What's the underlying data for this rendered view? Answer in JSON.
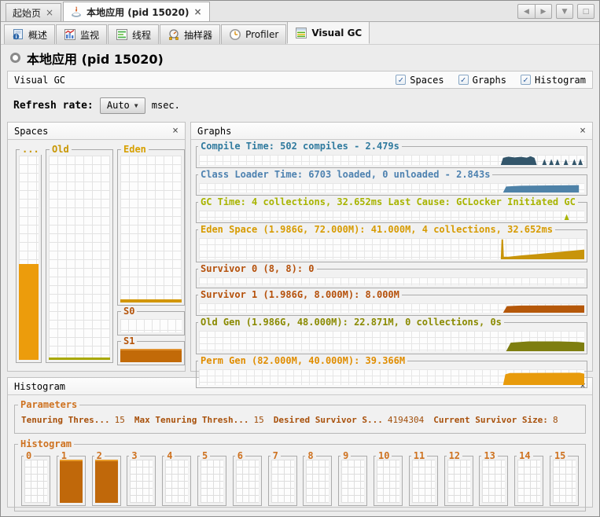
{
  "glyphs": {
    "close": "×",
    "check": "✓",
    "caret_down": "▼",
    "nav_left": "◀",
    "nav_right": "▶",
    "maximize": "□"
  },
  "doc_tabbar": {
    "tabs": [
      {
        "label": "起始页",
        "selected": false
      },
      {
        "label": "本地应用 (pid 15020)",
        "selected": true
      }
    ]
  },
  "view_tabbar": {
    "tabs": [
      {
        "label": "概述"
      },
      {
        "label": "监视"
      },
      {
        "label": "线程"
      },
      {
        "label": "抽样器"
      },
      {
        "label": "Profiler"
      },
      {
        "label": "Visual GC",
        "selected": true
      }
    ]
  },
  "page": {
    "title": "本地应用 (pid 15020)"
  },
  "toolbar": {
    "label": "Visual GC",
    "checkboxes": [
      {
        "label": "Spaces",
        "checked": true
      },
      {
        "label": "Graphs",
        "checked": true
      },
      {
        "label": "Histogram",
        "checked": true
      }
    ],
    "refresh": {
      "label": "Refresh rate:",
      "value": "Auto",
      "unit": "msec."
    }
  },
  "spaces": {
    "title": "Spaces",
    "perm": {
      "label": "...",
      "color": "#EC9C0C",
      "legend_color": "#C89600",
      "fill_percent": 47
    },
    "old": {
      "label": "Old",
      "color": "#A8A800",
      "legend_color": "#C89600",
      "fill_percent": 1
    },
    "eden": {
      "label": "Eden",
      "color": "#D29600",
      "legend_color": "#D7A000",
      "fill_percent": 2
    },
    "s0": {
      "label": "S0",
      "legend_color": "#B5540A",
      "fill_percent": 0
    },
    "s1": {
      "label": "S1",
      "color": "#C26A08",
      "legend_color": "#B5540A",
      "fill_percent": 100
    }
  },
  "graphs": {
    "title": "Graphs",
    "rows": [
      {
        "label": "Compile Time: 502 compiles - 2.479s",
        "color": "#2F7A9E",
        "fill": "#33566B"
      },
      {
        "label": "Class Loader Time: 6703 loaded, 0 unloaded - 2.843s",
        "color": "#4E82B0",
        "fill": "#4E82A8"
      },
      {
        "label": "GC Time: 4 collections, 32.652ms Last Cause: GCLocker Initiated GC",
        "color": "#A8B400",
        "fill": "#A8B400"
      },
      {
        "label": "Eden Space (1.986G, 72.000M): 41.000M, 4 collections, 32.652ms",
        "color": "#D79B00",
        "fill": "#C8940A"
      },
      {
        "label": "Survivor 0 (8, 8): 0",
        "color": "#B5500A",
        "fill": "#B5580A"
      },
      {
        "label": "Survivor 1 (1.986G, 8.000M): 8.000M",
        "color": "#B5500A",
        "fill": "#B5580A"
      },
      {
        "label": "Old Gen (1.986G, 48.000M): 22.871M, 0 collections, 0s",
        "color": "#8A8A00",
        "fill": "#7E7E10"
      },
      {
        "label": "Perm Gen (82.000M, 40.000M): 39.366M",
        "color": "#E08D00",
        "fill": "#E89B0C"
      }
    ]
  },
  "histogram": {
    "title": "Histogram",
    "parameters": {
      "legend": "Parameters",
      "legend_color": "#CE7220",
      "items": [
        {
          "label": "Tenuring Thres...",
          "value": "15"
        },
        {
          "label": "Max Tenuring Thresh...",
          "value": "15"
        },
        {
          "label": "Desired Survivor S...",
          "value": "4194304"
        },
        {
          "label": "Current Survivor Size:",
          "value": "8"
        }
      ]
    },
    "bins": {
      "legend": "Histogram",
      "legend_color": "#CE7220",
      "items": [
        {
          "label": "0",
          "filled": false
        },
        {
          "label": "1",
          "filled": true
        },
        {
          "label": "2",
          "filled": true
        },
        {
          "label": "3",
          "filled": false
        },
        {
          "label": "4",
          "filled": false
        },
        {
          "label": "5",
          "filled": false
        },
        {
          "label": "6",
          "filled": false
        },
        {
          "label": "7",
          "filled": false
        },
        {
          "label": "8",
          "filled": false
        },
        {
          "label": "9",
          "filled": false
        },
        {
          "label": "10",
          "filled": false
        },
        {
          "label": "11",
          "filled": false
        },
        {
          "label": "12",
          "filled": false
        },
        {
          "label": "13",
          "filled": false
        },
        {
          "label": "14",
          "filled": false
        },
        {
          "label": "15",
          "filled": false
        }
      ]
    }
  }
}
